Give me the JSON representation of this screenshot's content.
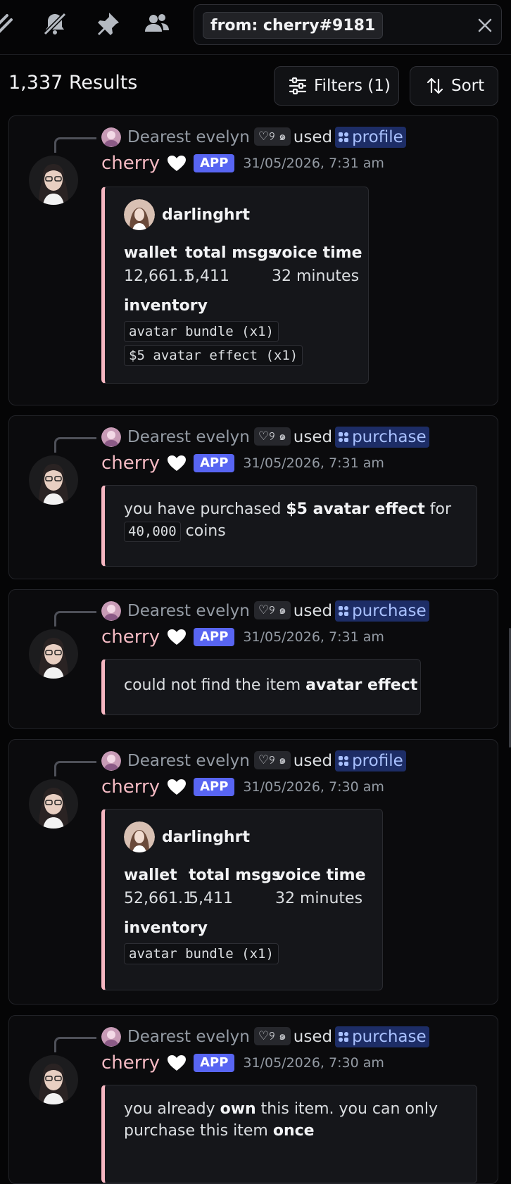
{
  "search": {
    "chip": "from: cherry#9181"
  },
  "results": {
    "count": "1,337 Results",
    "filters_label": "Filters (1)",
    "sort_label": "Sort"
  },
  "colors": {
    "accent": "#5865f2",
    "embed_border": "#f5b6c1",
    "author": "#f4bac3",
    "command": "#a9c1ff"
  },
  "cards": [
    {
      "reply": {
        "name": "Dearest evelyn",
        "tag": "♡୨ ๑",
        "used": "used",
        "command": "profile"
      },
      "author": "cherry",
      "badge": "APP",
      "timestamp": "31/05/2026, 7:31 am",
      "embed": {
        "author": "darlinghrt",
        "fields": [
          {
            "name": "wallet",
            "value": "12,661.1"
          },
          {
            "name": "total msgs",
            "value": "5,411"
          },
          {
            "name": "voice time",
            "value": "32 minutes"
          }
        ],
        "inventory_title": "inventory",
        "inventory": [
          "avatar bundle (x1)",
          "$5 avatar effect (x1)"
        ]
      }
    },
    {
      "reply": {
        "name": "Dearest evelyn",
        "tag": "♡୨ ๑",
        "used": "used",
        "command": "purchase"
      },
      "author": "cherry",
      "badge": "APP",
      "timestamp": "31/05/2026, 7:31 am",
      "message": {
        "t1": "you have purchased ",
        "b1": "$5 avatar effect",
        "t2": " for",
        "code": "40,000",
        "t3": " coins"
      }
    },
    {
      "reply": {
        "name": "Dearest evelyn",
        "tag": "♡୨ ๑",
        "used": "used",
        "command": "purchase"
      },
      "author": "cherry",
      "badge": "APP",
      "timestamp": "31/05/2026, 7:31 am",
      "message": {
        "t1": "could not find the item ",
        "b1": "avatar effect"
      }
    },
    {
      "reply": {
        "name": "Dearest evelyn",
        "tag": "♡୨ ๑",
        "used": "used",
        "command": "profile"
      },
      "author": "cherry",
      "badge": "APP",
      "timestamp": "31/05/2026, 7:30 am",
      "embed": {
        "author": "darlinghrt",
        "fields": [
          {
            "name": "wallet",
            "value": "52,661.1"
          },
          {
            "name": "total msgs",
            "value": "5,411"
          },
          {
            "name": "voice time",
            "value": "32 minutes"
          }
        ],
        "inventory_title": "inventory",
        "inventory": [
          "avatar bundle (x1)"
        ]
      }
    },
    {
      "reply": {
        "name": "Dearest evelyn",
        "tag": "♡୨ ๑",
        "used": "used",
        "command": "purchase"
      },
      "author": "cherry",
      "badge": "APP",
      "timestamp": "31/05/2026, 7:30 am",
      "message": {
        "t1": "you already ",
        "b1": "own",
        "t2": " this item. you can only",
        "t3": "purchase this item ",
        "b2": "once"
      }
    }
  ]
}
